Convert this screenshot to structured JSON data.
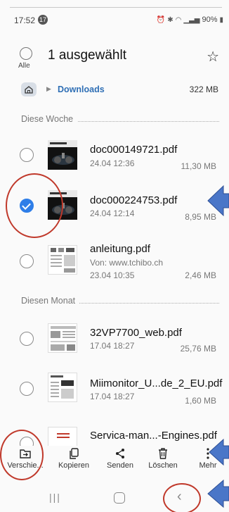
{
  "status": {
    "time": "17:52",
    "badge": "17",
    "battery": "90%"
  },
  "header": {
    "all_label": "Alle",
    "title": "1 ausgewählt",
    "star_icon": "star-icon"
  },
  "path": {
    "folder": "Downloads",
    "size": "322 MB"
  },
  "sections": [
    {
      "label": "Diese Woche"
    },
    {
      "label": "Diesen Monat"
    }
  ],
  "files": [
    {
      "name": "doc000149721.pdf",
      "date": "24.04 12:36",
      "size": "11,30 MB",
      "selected": false
    },
    {
      "name": "doc000224753.pdf",
      "date": "24.04 12:14",
      "size": "8,95 MB",
      "selected": true
    },
    {
      "name": "anleitung.pdf",
      "source": "Von: www.tchibo.ch",
      "date": "23.04 10:35",
      "size": "2,46 MB",
      "selected": false
    },
    {
      "name": "32VP7700_web.pdf",
      "date": "17.04 18:27",
      "size": "25,76 MB",
      "selected": false
    },
    {
      "name": "Miimonitor_U...de_2_EU.pdf",
      "date": "17.04 18:27",
      "size": "1,60 MB",
      "selected": false
    },
    {
      "name": "Servica-man...-Engines.pdf",
      "selected": false
    }
  ],
  "bottombar": {
    "move": "Verschie...",
    "copy": "Kopieren",
    "share": "Senden",
    "delete": "Löschen",
    "more": "Mehr"
  },
  "colors": {
    "accent": "#2f7ee8",
    "link": "#2f6fb5",
    "annotation_circle": "#c0392b",
    "annotation_arrow": "#4a76c8"
  }
}
